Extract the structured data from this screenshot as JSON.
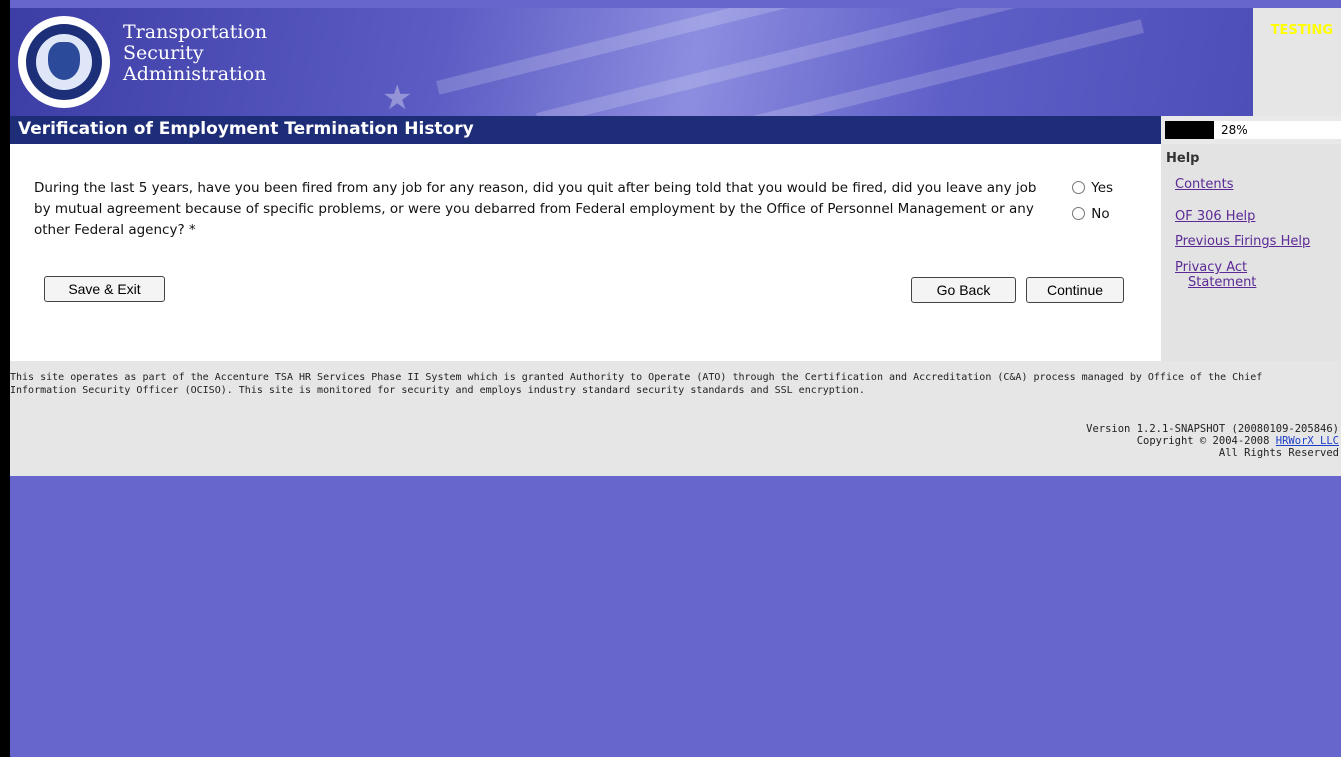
{
  "header": {
    "agency_line1": "Transportation",
    "agency_line2": "Security",
    "agency_line3": "Administration",
    "testing_label": "TESTING"
  },
  "page": {
    "title": "Verification of Employment Termination History",
    "progress_percent": 28,
    "progress_label": "28%"
  },
  "question": {
    "text": "During the last 5 years, have you been fired from any job for any reason, did you quit after being told that you would be fired, did you leave any job by mutual agreement because of specific problems, or were you debarred from Federal employment by the Office of Personnel Management or any other Federal agency? *",
    "option_yes": "Yes",
    "option_no": "No"
  },
  "buttons": {
    "save_exit": "Save & Exit",
    "go_back": "Go Back",
    "continue": "Continue"
  },
  "help": {
    "title": "Help",
    "links": [
      "Contents",
      "OF 306 Help",
      "Previous Firings Help",
      "Privacy Act",
      "Statement"
    ]
  },
  "footer": {
    "notice": "This site operates as part of the Accenture TSA HR Services Phase II System which is granted Authority to Operate (ATO) through the Certification and Accreditation (C&A) process managed by Office of the Chief Information Security Officer (OCISO). This site is monitored for security and employs industry standard security standards and SSL encryption.",
    "version": "Version 1.2.1-SNAPSHOT (20080109-205846)",
    "copyright_prefix": "Copyright © 2004-2008",
    "copyright_link": "HRWorX LLC",
    "rights": "All Rights Reserved"
  },
  "colors": {
    "background": "#6666cc",
    "title_bar": "#1e2d78",
    "testing": "#ffff00",
    "link": "#5b2a95"
  }
}
